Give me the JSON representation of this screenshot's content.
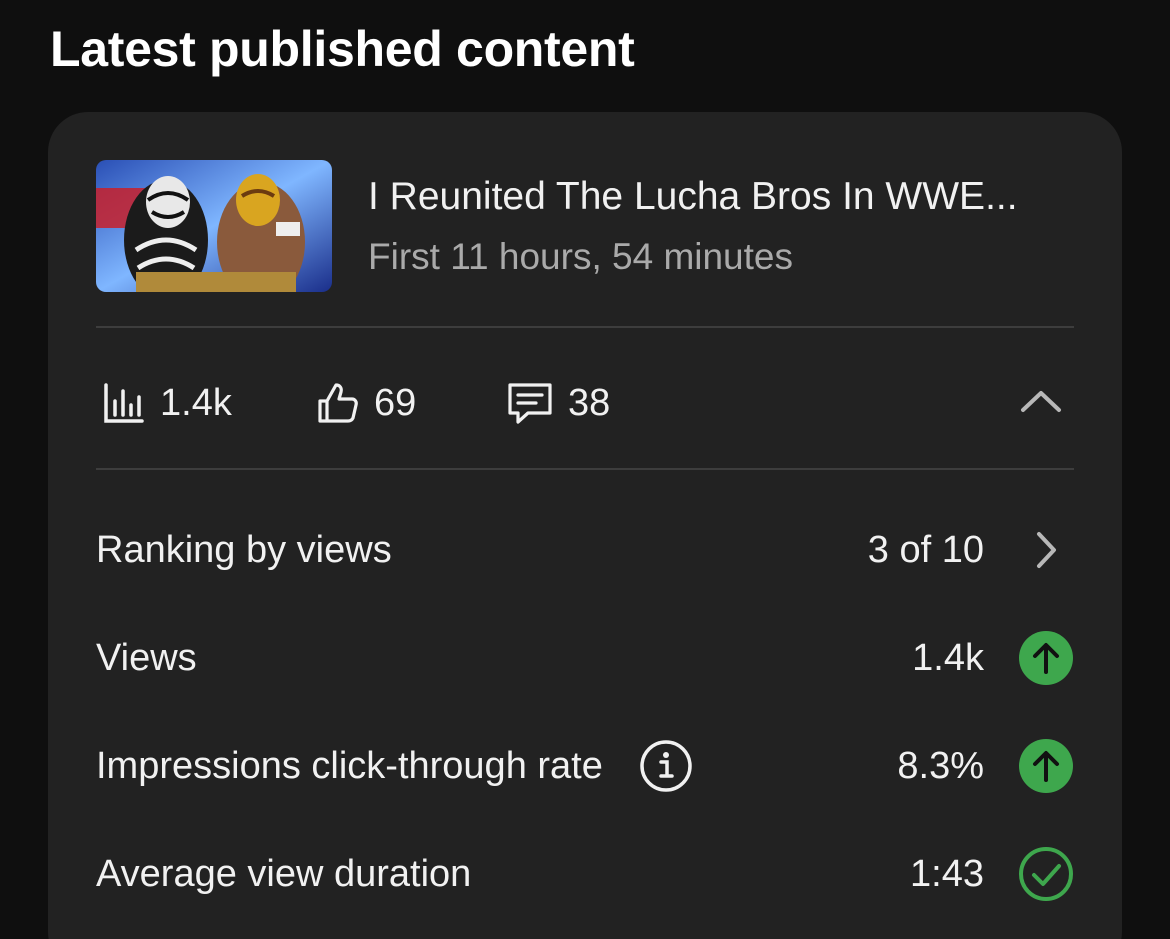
{
  "section": {
    "title": "Latest published content"
  },
  "video": {
    "title": "I Reunited The Lucha Bros In WWE...",
    "subtitle": "First 11 hours, 54 minutes",
    "thumbnail_icon": "video-thumbnail-wrestlers"
  },
  "stats": {
    "views": {
      "icon": "bar-chart-icon",
      "value": "1.4k"
    },
    "likes": {
      "icon": "thumbs-up-icon",
      "value": "69"
    },
    "comments": {
      "icon": "comment-icon",
      "value": "38"
    },
    "collapse_icon": "chevron-up-icon"
  },
  "metrics": [
    {
      "label": "Ranking by views",
      "value": "3 of 10",
      "trail_icon": "chevron-right-icon"
    },
    {
      "label": "Views",
      "value": "1.4k",
      "trail_icon": "arrow-up-circle-icon"
    },
    {
      "label": "Impressions click-through rate",
      "value": "8.3%",
      "info_icon": "info-icon",
      "trail_icon": "arrow-up-circle-icon"
    },
    {
      "label": "Average view duration",
      "value": "1:43",
      "trail_icon": "check-circle-icon"
    }
  ],
  "colors": {
    "background": "#0f0f0f",
    "card": "#222222",
    "positive": "#3ea74d",
    "text": "#f1f1f1",
    "muted": "#aaaaaa"
  }
}
